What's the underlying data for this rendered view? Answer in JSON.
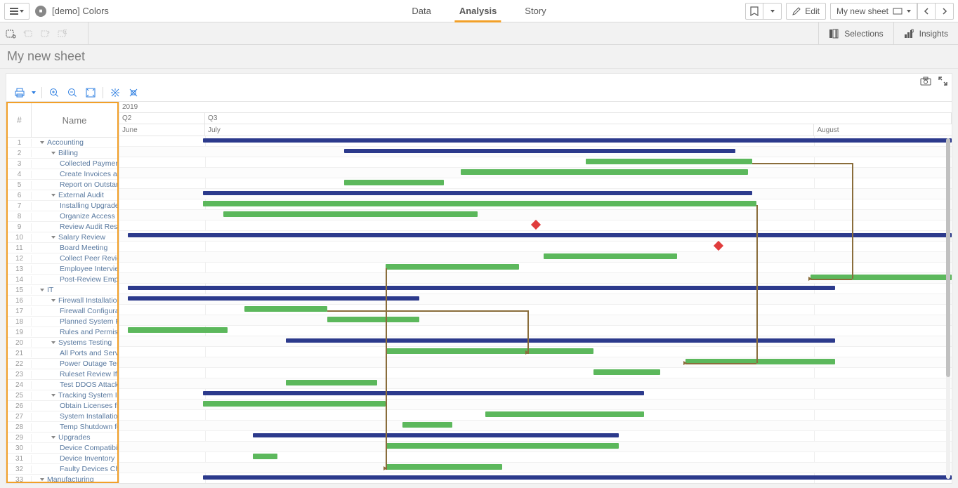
{
  "header": {
    "app_title": "[demo] Colors",
    "tabs": {
      "data": "Data",
      "analysis": "Analysis",
      "story": "Story"
    },
    "edit": "Edit",
    "sheet_nav_label": "My new sheet"
  },
  "selection_bar": {
    "selections": "Selections",
    "insights": "Insights"
  },
  "sheet": {
    "title": "My new sheet"
  },
  "gantt": {
    "columns": {
      "num": "#",
      "name": "Name"
    },
    "timeline": {
      "year": "2019",
      "quarters": [
        "Q2",
        "Q3"
      ],
      "months": [
        "June",
        "July",
        "August"
      ]
    },
    "rows": [
      {
        "n": 1,
        "indent": 1,
        "exp": true,
        "name": "Accounting",
        "type": "sum",
        "start": 10,
        "end": 100
      },
      {
        "n": 2,
        "indent": 2,
        "exp": true,
        "name": "Billing",
        "type": "sum",
        "start": 27,
        "end": 74
      },
      {
        "n": 3,
        "indent": 3,
        "name": "Collected Payments Review",
        "type": "task",
        "start": 56,
        "end": 76
      },
      {
        "n": 4,
        "indent": 3,
        "name": "Create Invoices and Send Invoices",
        "type": "task",
        "start": 41,
        "end": 75.5
      },
      {
        "n": 5,
        "indent": 3,
        "name": "Report on Outstanding Collections",
        "type": "task",
        "start": 27,
        "end": 39
      },
      {
        "n": 6,
        "indent": 2,
        "exp": true,
        "name": "External Audit",
        "type": "sum",
        "start": 10,
        "end": 76
      },
      {
        "n": 7,
        "indent": 3,
        "name": "Installing Upgrades",
        "type": "task",
        "start": 10,
        "end": 76.5
      },
      {
        "n": 8,
        "indent": 3,
        "name": "Organize Access for External Auditors",
        "type": "task",
        "start": 12.5,
        "end": 43
      },
      {
        "n": 9,
        "indent": 3,
        "name": "Review Audit Results",
        "type": "milestone",
        "pos": 50
      },
      {
        "n": 10,
        "indent": 2,
        "exp": true,
        "name": "Salary Review",
        "type": "sum",
        "start": 1,
        "end": 100
      },
      {
        "n": 11,
        "indent": 3,
        "name": "Board Meeting",
        "type": "milestone",
        "pos": 72
      },
      {
        "n": 12,
        "indent": 3,
        "name": "Collect Peer Review Data",
        "type": "task",
        "start": 51,
        "end": 67
      },
      {
        "n": 13,
        "indent": 3,
        "name": "Employee Interviews",
        "type": "task",
        "start": 32,
        "end": 48
      },
      {
        "n": 14,
        "indent": 3,
        "name": "Post-Review Employee Interviews",
        "type": "task",
        "start": 83,
        "end": 100
      },
      {
        "n": 15,
        "indent": 1,
        "exp": true,
        "name": "IT",
        "type": "sum",
        "start": 1,
        "end": 86
      },
      {
        "n": 16,
        "indent": 2,
        "exp": true,
        "name": "Firewall Installation",
        "type": "sum",
        "start": 1,
        "end": 36
      },
      {
        "n": 17,
        "indent": 3,
        "name": "Firewall Configuration",
        "type": "task",
        "start": 15,
        "end": 25
      },
      {
        "n": 18,
        "indent": 3,
        "name": "Planned System Restart",
        "type": "task",
        "start": 25,
        "end": 36
      },
      {
        "n": 19,
        "indent": 3,
        "name": "Rules and Permissions Audit",
        "type": "task",
        "start": 1,
        "end": 13
      },
      {
        "n": 20,
        "indent": 2,
        "exp": true,
        "name": "Systems Testing",
        "type": "sum",
        "start": 20,
        "end": 86
      },
      {
        "n": 21,
        "indent": 3,
        "name": "All Ports and Services Test",
        "type": "task",
        "start": 32,
        "end": 57
      },
      {
        "n": 22,
        "indent": 3,
        "name": "Power Outage Tests",
        "type": "task",
        "start": 68,
        "end": 86
      },
      {
        "n": 23,
        "indent": 3,
        "name": "Ruleset Review If Needed",
        "type": "task",
        "start": 57,
        "end": 65
      },
      {
        "n": 24,
        "indent": 3,
        "name": "Test DDOS Attack",
        "type": "task",
        "start": 20,
        "end": 31
      },
      {
        "n": 25,
        "indent": 2,
        "exp": true,
        "name": "Tracking System Installation",
        "type": "sum",
        "start": 10,
        "end": 63
      },
      {
        "n": 26,
        "indent": 3,
        "name": "Obtain Licenses from the Vendor",
        "type": "task",
        "start": 10,
        "end": 32
      },
      {
        "n": 27,
        "indent": 3,
        "name": "System Installation",
        "type": "task",
        "start": 44,
        "end": 63
      },
      {
        "n": 28,
        "indent": 3,
        "name": "Temp Shutdown for IT Audit",
        "type": "task",
        "start": 34,
        "end": 40
      },
      {
        "n": 29,
        "indent": 2,
        "exp": true,
        "name": "Upgrades",
        "type": "sum",
        "start": 16,
        "end": 60
      },
      {
        "n": 30,
        "indent": 3,
        "name": "Device Compatibility Review",
        "type": "task",
        "start": 32,
        "end": 60
      },
      {
        "n": 31,
        "indent": 3,
        "name": "Device Inventory",
        "type": "task",
        "start": 16,
        "end": 19
      },
      {
        "n": 32,
        "indent": 3,
        "name": "Faulty Devices Check",
        "type": "task",
        "start": 32,
        "end": 46
      },
      {
        "n": 33,
        "indent": 1,
        "exp": true,
        "name": "Manufacturing",
        "type": "sum",
        "start": 10,
        "end": 100
      }
    ],
    "dependencies": [
      {
        "from_row": 3,
        "from_pct": 76,
        "to_row": 14,
        "to_pct": 83,
        "via": 88
      },
      {
        "from_row": 7,
        "from_pct": 76.5,
        "to_row": 22,
        "to_pct": 68,
        "via": 76.5
      },
      {
        "from_row": 13,
        "from_pct": 32,
        "to_row": 32,
        "to_pct": 32
      },
      {
        "from_row": 17,
        "from_pct": 25,
        "to_row": 21,
        "to_pct": 49,
        "via": 49
      }
    ]
  },
  "chart_data": {
    "type": "gantt",
    "title": "",
    "time_axis": {
      "year": 2019,
      "quarters": [
        "Q2",
        "Q3"
      ],
      "months": [
        "June",
        "July",
        "August"
      ]
    },
    "month_edges_pct": {
      "June": 0,
      "July": 10.3,
      "August": 83.5
    },
    "series": [
      {
        "name": "Accounting",
        "type": "summary",
        "start_pct": 10,
        "end_pct": 100,
        "children": [
          {
            "name": "Billing",
            "type": "summary",
            "start_pct": 27,
            "end_pct": 74,
            "children": [
              {
                "name": "Collected Payments Review",
                "type": "task",
                "start_pct": 56,
                "end_pct": 76
              },
              {
                "name": "Create Invoices and Send Invoices",
                "type": "task",
                "start_pct": 41,
                "end_pct": 75.5
              },
              {
                "name": "Report on Outstanding Collections",
                "type": "task",
                "start_pct": 27,
                "end_pct": 39
              }
            ]
          },
          {
            "name": "External Audit",
            "type": "summary",
            "start_pct": 10,
            "end_pct": 76,
            "children": [
              {
                "name": "Installing Upgrades",
                "type": "task",
                "start_pct": 10,
                "end_pct": 76.5
              },
              {
                "name": "Organize Access for External Auditors",
                "type": "task",
                "start_pct": 12.5,
                "end_pct": 43
              },
              {
                "name": "Review Audit Results",
                "type": "milestone",
                "at_pct": 50
              }
            ]
          },
          {
            "name": "Salary Review",
            "type": "summary",
            "start_pct": 1,
            "end_pct": 100,
            "children": [
              {
                "name": "Board Meeting",
                "type": "milestone",
                "at_pct": 72
              },
              {
                "name": "Collect Peer Review Data",
                "type": "task",
                "start_pct": 51,
                "end_pct": 67
              },
              {
                "name": "Employee Interviews",
                "type": "task",
                "start_pct": 32,
                "end_pct": 48
              },
              {
                "name": "Post-Review Employee Interviews",
                "type": "task",
                "start_pct": 83,
                "end_pct": 100
              }
            ]
          }
        ]
      },
      {
        "name": "IT",
        "type": "summary",
        "start_pct": 1,
        "end_pct": 86,
        "children": [
          {
            "name": "Firewall Installation",
            "type": "summary",
            "start_pct": 1,
            "end_pct": 36,
            "children": [
              {
                "name": "Firewall Configuration",
                "type": "task",
                "start_pct": 15,
                "end_pct": 25
              },
              {
                "name": "Planned System Restart",
                "type": "task",
                "start_pct": 25,
                "end_pct": 36
              },
              {
                "name": "Rules and Permissions Audit",
                "type": "task",
                "start_pct": 1,
                "end_pct": 13
              }
            ]
          },
          {
            "name": "Systems Testing",
            "type": "summary",
            "start_pct": 20,
            "end_pct": 86,
            "children": [
              {
                "name": "All Ports and Services Test",
                "type": "task",
                "start_pct": 32,
                "end_pct": 57
              },
              {
                "name": "Power Outage Tests",
                "type": "task",
                "start_pct": 68,
                "end_pct": 86
              },
              {
                "name": "Ruleset Review If Needed",
                "type": "task",
                "start_pct": 57,
                "end_pct": 65
              },
              {
                "name": "Test DDOS Attack",
                "type": "task",
                "start_pct": 20,
                "end_pct": 31
              }
            ]
          },
          {
            "name": "Tracking System Installation",
            "type": "summary",
            "start_pct": 10,
            "end_pct": 63,
            "children": [
              {
                "name": "Obtain Licenses from the Vendor",
                "type": "task",
                "start_pct": 10,
                "end_pct": 32
              },
              {
                "name": "System Installation",
                "type": "task",
                "start_pct": 44,
                "end_pct": 63
              },
              {
                "name": "Temp Shutdown for IT Audit",
                "type": "task",
                "start_pct": 34,
                "end_pct": 40
              }
            ]
          },
          {
            "name": "Upgrades",
            "type": "summary",
            "start_pct": 16,
            "end_pct": 60,
            "children": [
              {
                "name": "Device Compatibility Review",
                "type": "task",
                "start_pct": 32,
                "end_pct": 60
              },
              {
                "name": "Device Inventory",
                "type": "task",
                "start_pct": 16,
                "end_pct": 19
              },
              {
                "name": "Faulty Devices Check",
                "type": "task",
                "start_pct": 32,
                "end_pct": 46
              }
            ]
          }
        ]
      },
      {
        "name": "Manufacturing",
        "type": "summary",
        "start_pct": 10,
        "end_pct": 100
      }
    ]
  }
}
